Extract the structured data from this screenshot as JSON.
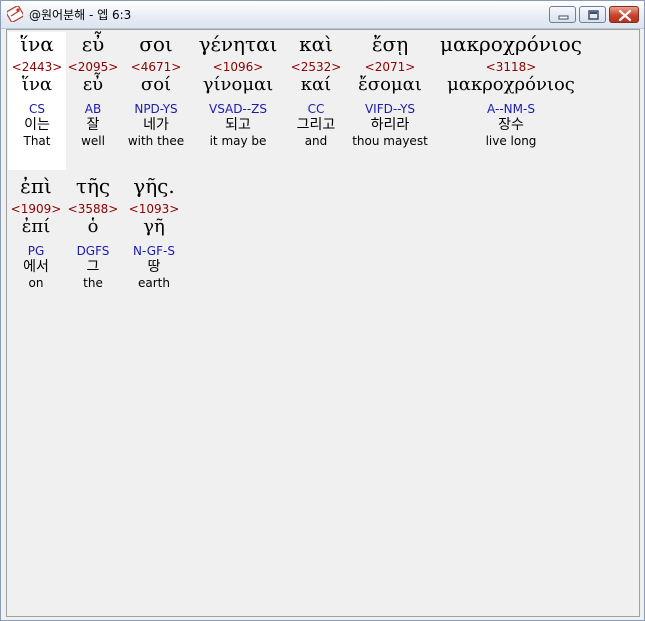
{
  "window": {
    "title": "@원어분해 - 엡 6:3"
  },
  "colors": {
    "strong_number": "#8b0000",
    "parsing_code": "#1a1ab0",
    "highlight": "#ffffff"
  },
  "words": [
    {
      "greek": "ἵνα",
      "strong": "<2443>",
      "lemma": "ἵνα",
      "parse": "CS",
      "korean": "이는",
      "english": "That",
      "highlighted": true
    },
    {
      "greek": "εὖ",
      "strong": "<2095>",
      "lemma": "εὖ",
      "parse": "AB",
      "korean": "잘",
      "english": "well",
      "highlighted": false
    },
    {
      "greek": "σοι",
      "strong": "<4671>",
      "lemma": "σοί",
      "parse": "NPD-YS",
      "korean": "네가",
      "english": "with thee",
      "highlighted": false
    },
    {
      "greek": "γένηται",
      "strong": "<1096>",
      "lemma": "γίνομαι",
      "parse": "VSAD--ZS",
      "korean": "되고",
      "english": "it may be",
      "highlighted": false
    },
    {
      "greek": "καὶ",
      "strong": "<2532>",
      "lemma": "καί",
      "parse": "CC",
      "korean": "그리고",
      "english": "and",
      "highlighted": false
    },
    {
      "greek": "ἔσῃ",
      "strong": "<2071>",
      "lemma": "ἔσομαι",
      "parse": "VIFD--YS",
      "korean": "하리라",
      "english": "thou mayest",
      "highlighted": false
    },
    {
      "greek": "μακροχρόνιος",
      "strong": "<3118>",
      "lemma": "μακροχρόνιος",
      "parse": "A--NM-S",
      "korean": "장수",
      "english": "live long",
      "highlighted": false
    },
    {
      "greek": "ἐπὶ",
      "strong": "<1909>",
      "lemma": "ἐπί",
      "parse": "PG",
      "korean": "에서",
      "english": "on",
      "highlighted": false
    },
    {
      "greek": "τῆς",
      "strong": "<3588>",
      "lemma": "ὁ",
      "parse": "DGFS",
      "korean": "그",
      "english": "the",
      "highlighted": false
    },
    {
      "greek": "γῆς.",
      "strong": "<1093>",
      "lemma": "γῆ",
      "parse": "N-GF-S",
      "korean": "땅",
      "english": "earth",
      "highlighted": false
    }
  ]
}
